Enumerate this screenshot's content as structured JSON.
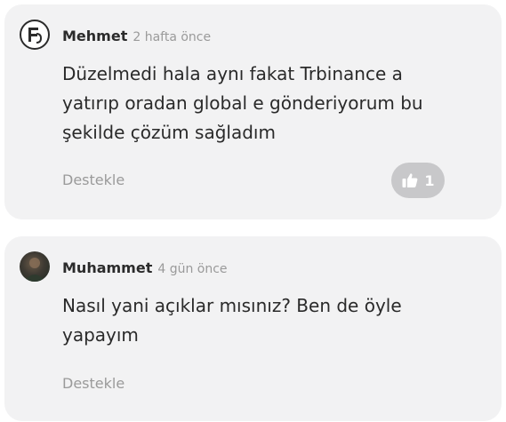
{
  "comments": [
    {
      "author": "Mehmet",
      "time": "2 hafta önce",
      "line1": "Düzelmedi hala aynı fakat Trbinance a",
      "line2": "yatırıp oradan global e gönderiyorum bu",
      "line3": "şekilde çözüm sağladım",
      "support_label": "Destekle",
      "likes": "1",
      "like_icon": "thumbs-up-icon"
    },
    {
      "author": "Muhammet",
      "time": "4 gün önce",
      "line1": "Nasıl yani açıklar mısınız? Ben de öyle",
      "line2": "yapayım",
      "support_label": "Destekle"
    }
  ],
  "colors": {
    "card_bg": "#f2f2f3",
    "muted": "#9a9a9a",
    "text": "#2a2a2a",
    "like_pill": "#c8c8ca"
  }
}
